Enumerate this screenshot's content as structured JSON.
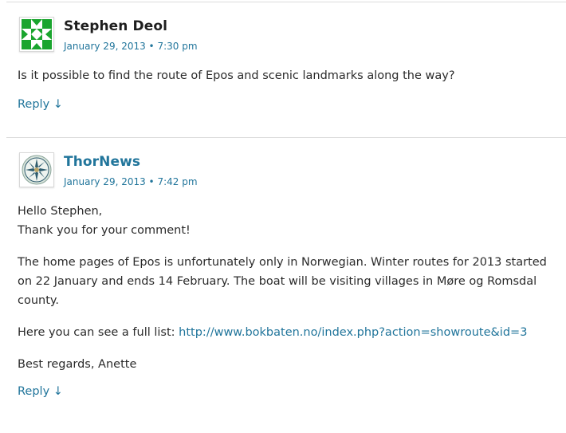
{
  "comments": [
    {
      "author": "Stephen Deol",
      "date": "January 29, 2013 • 7:30 pm",
      "avatar_icon": "green-geometric-avatar-icon",
      "paragraphs": [
        "Is it possible to find the route of Epos and scenic landmarks along the way?"
      ],
      "reply_label": "Reply ↓"
    },
    {
      "author": "ThorNews",
      "date": "January 29, 2013 • 7:42 pm",
      "avatar_icon": "star-emblem-avatar-icon",
      "greeting_line1": "Hello Stephen,",
      "greeting_line2": "Thank you for your comment!",
      "paragraph2": "The home pages of Epos is unfortunately only in Norwegian. Winter routes for 2013 started on 22 January and ends 14 February. The boat will be visiting villages in Møre og Romsdal county.",
      "list_prefix": "Here you can see a full list: ",
      "list_url": "http://www.bokbaten.no/index.php?action=showroute&id=3",
      "signoff": "Best regards, Anette",
      "reply_label": "Reply ↓"
    }
  ],
  "colors": {
    "link": "#21759b",
    "text": "#2b2b2b",
    "divider": "#dcdcdc",
    "avatar_green": "#1aa52e"
  }
}
